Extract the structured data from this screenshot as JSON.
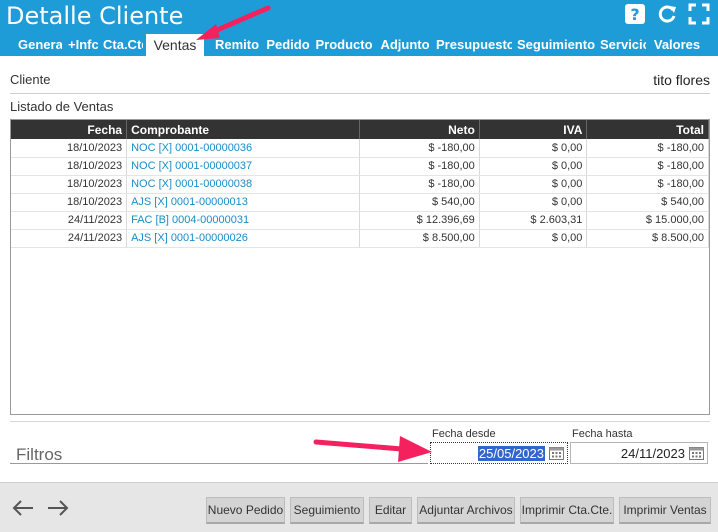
{
  "header": {
    "title": "Detalle Cliente",
    "tabs": [
      "Genera",
      "+Infc",
      "Cta.Cte",
      "Ventas",
      "Remito",
      "Pedido",
      "Producto",
      "Adjunto",
      "Presupuesto",
      "Seguimiento",
      "Servicio",
      "Valores"
    ],
    "active_tab": "Ventas"
  },
  "cliente": {
    "label": "Cliente",
    "value": "tito flores"
  },
  "listado_label": "Listado de Ventas",
  "table": {
    "columns": [
      "Fecha",
      "Comprobante",
      "Neto",
      "IVA",
      "Total"
    ],
    "rows": [
      [
        "18/10/2023",
        "NOC [X] 0001-00000036",
        "$ -180,00",
        "$ 0,00",
        "$ -180,00"
      ],
      [
        "18/10/2023",
        "NOC [X] 0001-00000037",
        "$ -180,00",
        "$ 0,00",
        "$ -180,00"
      ],
      [
        "18/10/2023",
        "NOC [X] 0001-00000038",
        "$ -180,00",
        "$ 0,00",
        "$ -180,00"
      ],
      [
        "18/10/2023",
        "AJS [X] 0001-00000013",
        "$ 540,00",
        "$ 0,00",
        "$ 540,00"
      ],
      [
        "24/11/2023",
        "FAC [B] 0004-00000031",
        "$ 12.396,69",
        "$ 2.603,31",
        "$ 15.000,00"
      ],
      [
        "24/11/2023",
        "AJS [X] 0001-00000026",
        "$ 8.500,00",
        "$ 0,00",
        "$ 8.500,00"
      ]
    ]
  },
  "filtros": {
    "label": "Filtros",
    "desde_label": "Fecha desde",
    "desde_value": "25/05/2023",
    "hasta_label": "Fecha hasta",
    "hasta_value": "24/11/2023"
  },
  "footer": {
    "buttons": [
      "Nuevo Pedido",
      "Seguimiento",
      "Editar",
      "Adjuntar Archivos",
      "Imprimir Cta.Cte.",
      "Imprimir Ventas"
    ]
  },
  "colors": {
    "header": "#1e9cd7",
    "link": "#1a8dc8",
    "annotation_arrow": "#f5205e",
    "grid_header": "#333333"
  },
  "icons": [
    "help-icon",
    "refresh-icon",
    "expand-icon",
    "back-arrow-icon",
    "forward-arrow-icon",
    "calendar-icon"
  ]
}
